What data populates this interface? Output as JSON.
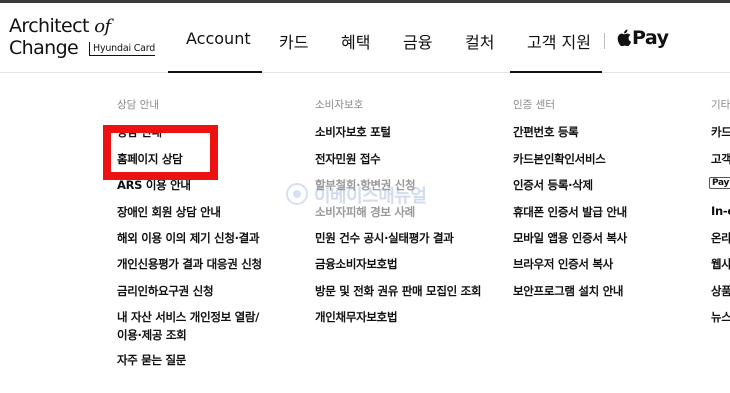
{
  "logo": {
    "line1": "Architect",
    "line1_italic": "of",
    "line2": "Change",
    "card_label": "Hyundai Card"
  },
  "nav": {
    "items": [
      "Account",
      "카드",
      "혜택",
      "금융",
      "컬처",
      "고객 지원"
    ],
    "pay_label": "Pay"
  },
  "columns": [
    {
      "title": "상담 안내",
      "items": [
        "상담 안내",
        "홈페이지 상담",
        "ARS 이용 안내",
        "장애인 회원 상담 안내",
        "해외 이용 이의 제기 신청·결과",
        "개인신용평가 결과 대응권 신청",
        "금리인하요구권 신청",
        "내 자산 서비스 개인정보 열람/",
        "이용·제공 조회",
        "자주 묻는 질문"
      ]
    },
    {
      "title": "소비자보호",
      "items": [
        "소비자보호 포털",
        "전자민원 접수",
        "할부철회·항변권 신청",
        "소비자피해 경보 사례",
        "민원 건수 공시·실태평가 결과",
        "금융소비자보호법",
        "방문 및 전화 권유 판매 모집인 조회",
        "개인채무자보호법"
      ]
    },
    {
      "title": "인증 센터",
      "items": [
        "간편번호 등록",
        "카드본인확인서비스",
        "인증서 등록·삭제",
        "휴대폰 인증서 발급 안내",
        "모바일 앱용 인증서 복사",
        "브라우저 인증서 복사",
        "보안프로그램 설치 안내"
      ]
    },
    {
      "title": "기타",
      "items": [
        "카드",
        "고객",
        "Pay",
        "In-c",
        "온라",
        "웹사",
        "상품",
        "뉴스"
      ]
    }
  ],
  "watermark": {
    "text": "이베이스매뉴얼"
  },
  "colors": {
    "highlight": "#ee1111",
    "text": "#111111",
    "muted": "#8a8a8a"
  }
}
